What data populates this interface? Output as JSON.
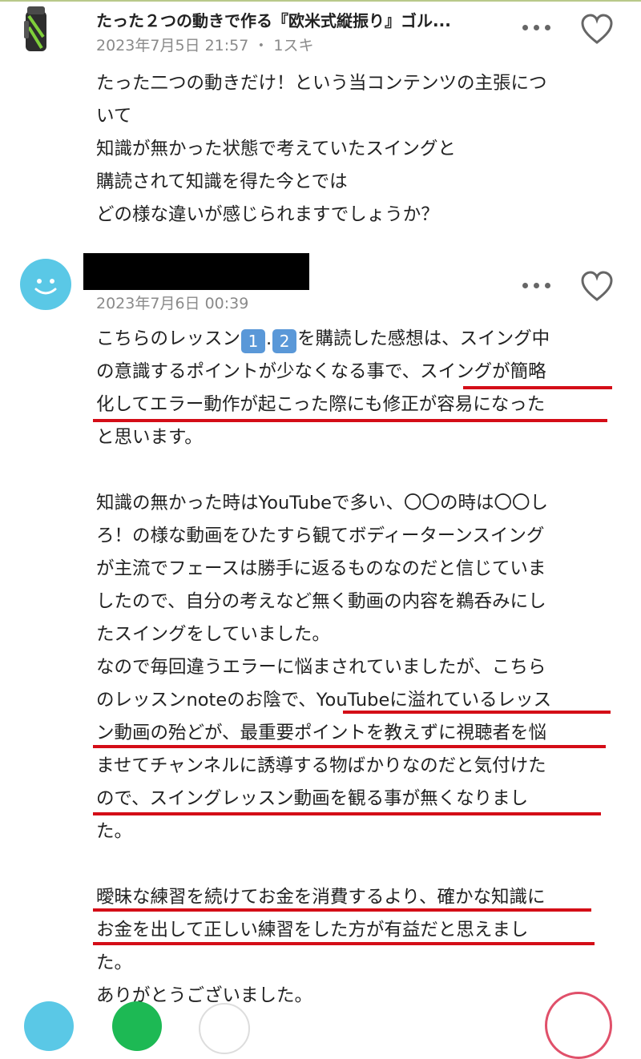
{
  "comment1": {
    "title": "たった２つの動きで作る『欧米式縦振り』ゴル...",
    "meta": "2023年7月5日 21:57 ・ 1スキ",
    "lines": [
      "たった二つの動きだけ！という当コンテンツの主張につ",
      "いて",
      "知識が無かった状態で考えていたスイングと",
      "購読されて知識を得た今とでは",
      "どの様な違いが感じられますでしょうか？"
    ]
  },
  "comment2": {
    "date": "2023年7月6日 00:39",
    "line1_before": "こちらのレッスン",
    "key1": "1",
    "dot": ".",
    "key2": "2",
    "line1_after": "を購読した感想は、スイング中",
    "lines": [
      "の意識するポイントが少なくなる事で、スイングが簡略",
      "化してエラー動作が起こった際にも修正が容易になった",
      "と思います。",
      "",
      "知識の無かった時はYouTubeで多い、〇〇の時は〇〇し",
      "ろ！の様な動画をひたすら観てボディーターンスイング",
      "が主流でフェースは勝手に返るものなのだと信じていま",
      "したので、自分の考えなど無く動画の内容を鵜呑みにし",
      "たスイングをしていました。",
      "なので毎回違うエラーに悩まされていましたが、こちら",
      "のレッスンnoteのお陰で、YouTubeに溢れているレッス",
      "ン動画の殆どが、最重要ポイントを教えずに視聴者を悩",
      "ませてチャンネルに誘導する物ばかりなのだと気付けた",
      "ので、スイングレッスン動画を観る事が無くなりまし",
      "た。",
      "",
      "曖昧な練習を続けてお金を消費するより、確かな知識に",
      "お金を出して正しい練習をした方が有益だと思えまし",
      "た。",
      "ありがとうございました。"
    ]
  },
  "colors": {
    "accent_red": "#d40d17",
    "avatar_blue": "#5ac8e6",
    "meta_gray": "#8a8a8a"
  },
  "icons": [
    "golf-bag-avatar",
    "more-dots-icon",
    "heart-icon",
    "smiley-avatar-icon"
  ]
}
